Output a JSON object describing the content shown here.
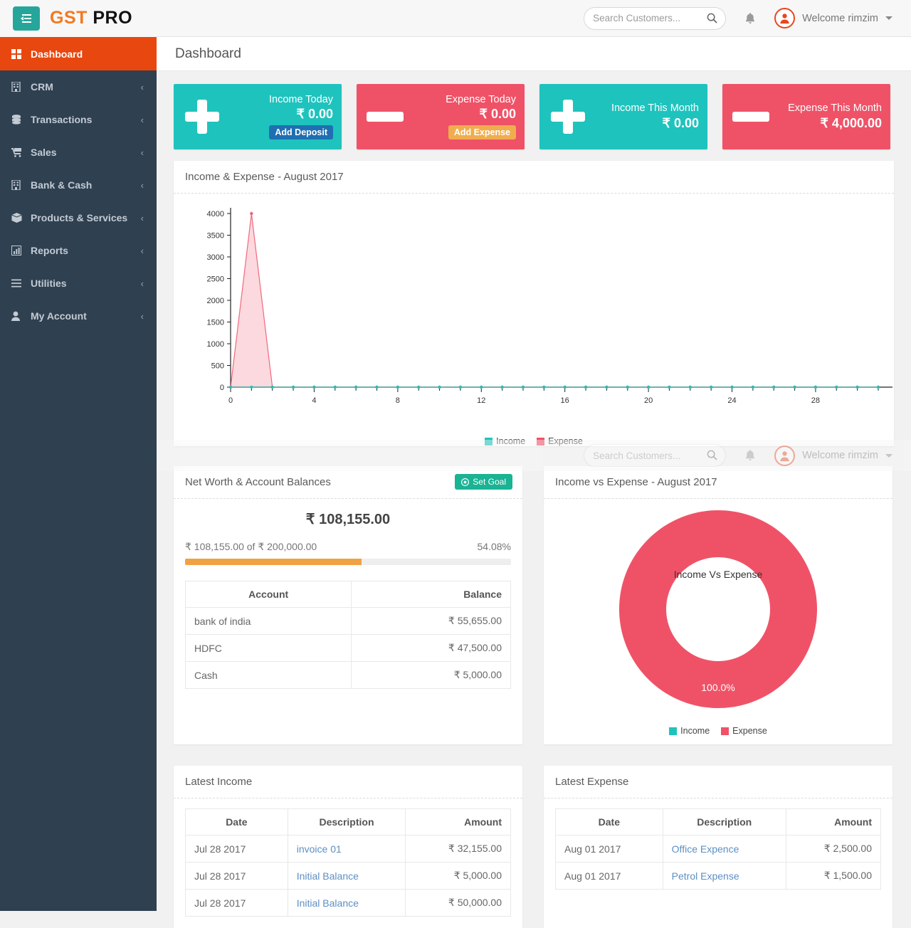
{
  "header": {
    "logo_gst": "GST",
    "logo_pro": " PRO",
    "menu_toggle_icon": "hamburger-collapse-icon",
    "search": {
      "placeholder": "Search Customers...",
      "value": "",
      "icon": "search-icon"
    },
    "notification_icon": "bell-icon",
    "avatar_icon": "user-avatar-icon",
    "welcome_text": "Welcome rimzim",
    "caret_icon": "caret-down-icon"
  },
  "sidebar": {
    "items": [
      {
        "label": "Dashboard",
        "icon": "grid-icon",
        "active": true,
        "chevron": ""
      },
      {
        "label": "CRM",
        "icon": "building-icon",
        "active": false,
        "chevron": "‹"
      },
      {
        "label": "Transactions",
        "icon": "database-icon",
        "active": false,
        "chevron": "‹"
      },
      {
        "label": "Sales",
        "icon": "cart-icon",
        "active": false,
        "chevron": "‹"
      },
      {
        "label": "Bank & Cash",
        "icon": "bank-icon",
        "active": false,
        "chevron": "‹"
      },
      {
        "label": "Products & Services",
        "icon": "box-icon",
        "active": false,
        "chevron": "‹"
      },
      {
        "label": "Reports",
        "icon": "bar-chart-icon",
        "active": false,
        "chevron": "‹"
      },
      {
        "label": "Utilities",
        "icon": "list-icon",
        "active": false,
        "chevron": "‹"
      },
      {
        "label": "My Account",
        "icon": "person-icon",
        "active": false,
        "chevron": "‹"
      }
    ]
  },
  "page": {
    "title": "Dashboard"
  },
  "stats": [
    {
      "title": "Income Today",
      "amount": "₹ 0.00",
      "button": "Add Deposit",
      "theme": "teal",
      "icon": "plus-icon",
      "btn_color": "blue"
    },
    {
      "title": "Expense Today",
      "amount": "₹ 0.00",
      "button": "Add Expense",
      "theme": "red",
      "icon": "minus-icon",
      "btn_color": "orange"
    },
    {
      "title": "Income This Month",
      "amount": "₹ 0.00",
      "button": "",
      "theme": "teal",
      "icon": "plus-icon",
      "btn_color": ""
    },
    {
      "title": "Expense This Month",
      "amount": "₹ 4,000.00",
      "button": "",
      "theme": "red",
      "icon": "minus-icon",
      "btn_color": ""
    }
  ],
  "line_panel": {
    "title": "Income & Expense - August 2017"
  },
  "networth": {
    "title": "Net Worth & Account Balances",
    "set_goal_label": "Set Goal",
    "set_goal_icon": "target-icon",
    "total": "₹ 108,155.00",
    "goal_text": "₹ 108,155.00 of ₹ 200,000.00",
    "percent_text": "54.08%",
    "percent_value": 54.08,
    "table": {
      "columns": [
        "Account",
        "Balance"
      ],
      "rows": [
        [
          "bank of india",
          "₹ 55,655.00"
        ],
        [
          "HDFC",
          "₹ 47,500.00"
        ],
        [
          "Cash",
          "₹ 5,000.00"
        ]
      ]
    }
  },
  "donut_panel": {
    "title": "Income vs Expense - August 2017"
  },
  "latest_income": {
    "title": "Latest Income",
    "columns": [
      "Date",
      "Description",
      "Amount"
    ],
    "rows": [
      [
        "Jul 28 2017",
        "invoice 01",
        "₹ 32,155.00"
      ],
      [
        "Jul 28 2017",
        "Initial Balance",
        "₹ 5,000.00"
      ],
      [
        "Jul 28 2017",
        "Initial Balance",
        "₹ 50,000.00"
      ]
    ]
  },
  "latest_expense": {
    "title": "Latest Expense",
    "columns": [
      "Date",
      "Description",
      "Amount"
    ],
    "rows": [
      [
        "Aug 01 2017",
        "Office Expence",
        "₹ 2,500.00"
      ],
      [
        "Aug 01 2017",
        "Petrol Expense",
        "₹ 1,500.00"
      ]
    ]
  },
  "colors": {
    "income": "#1fc3bd",
    "expense": "#ef5267",
    "sidebar": "#2f4050",
    "active": "#e8470f",
    "brand_orange": "#f47920",
    "goal_bar": "#f0a243",
    "set_goal": "#1ab394"
  },
  "chart_data": [
    {
      "type": "area",
      "title": "Income & Expense - August 2017",
      "xlabel": "",
      "ylabel": "",
      "xlim": [
        0,
        31
      ],
      "ylim": [
        0,
        4000
      ],
      "xticks": [
        0,
        4,
        8,
        12,
        16,
        20,
        24,
        28
      ],
      "yticks": [
        0,
        500,
        1000,
        1500,
        2000,
        2500,
        3000,
        3500,
        4000
      ],
      "grid": false,
      "legend": [
        "Income",
        "Expense"
      ],
      "legend_position": "bottom",
      "x": [
        0,
        1,
        2,
        3,
        4,
        5,
        6,
        7,
        8,
        9,
        10,
        11,
        12,
        13,
        14,
        15,
        16,
        17,
        18,
        19,
        20,
        21,
        22,
        23,
        24,
        25,
        26,
        27,
        28,
        29,
        30,
        31
      ],
      "series": [
        {
          "name": "Income",
          "color": "#1fc3bd",
          "values": [
            0,
            0,
            0,
            0,
            0,
            0,
            0,
            0,
            0,
            0,
            0,
            0,
            0,
            0,
            0,
            0,
            0,
            0,
            0,
            0,
            0,
            0,
            0,
            0,
            0,
            0,
            0,
            0,
            0,
            0,
            0,
            0
          ]
        },
        {
          "name": "Expense",
          "color": "#ef5267",
          "values": [
            0,
            4000,
            0,
            0,
            0,
            0,
            0,
            0,
            0,
            0,
            0,
            0,
            0,
            0,
            0,
            0,
            0,
            0,
            0,
            0,
            0,
            0,
            0,
            0,
            0,
            0,
            0,
            0,
            0,
            0,
            0,
            0
          ]
        }
      ]
    },
    {
      "type": "pie",
      "title": "Income vs Expense - August 2017",
      "center_label": "Income Vs Expense",
      "donut": true,
      "legend": [
        "Income",
        "Expense"
      ],
      "legend_position": "bottom",
      "labels": [
        "Income",
        "Expense"
      ],
      "values": [
        0,
        100
      ],
      "value_labels": [
        "",
        "100.0%"
      ],
      "colors": [
        "#1fc3bd",
        "#ef5267"
      ]
    }
  ]
}
